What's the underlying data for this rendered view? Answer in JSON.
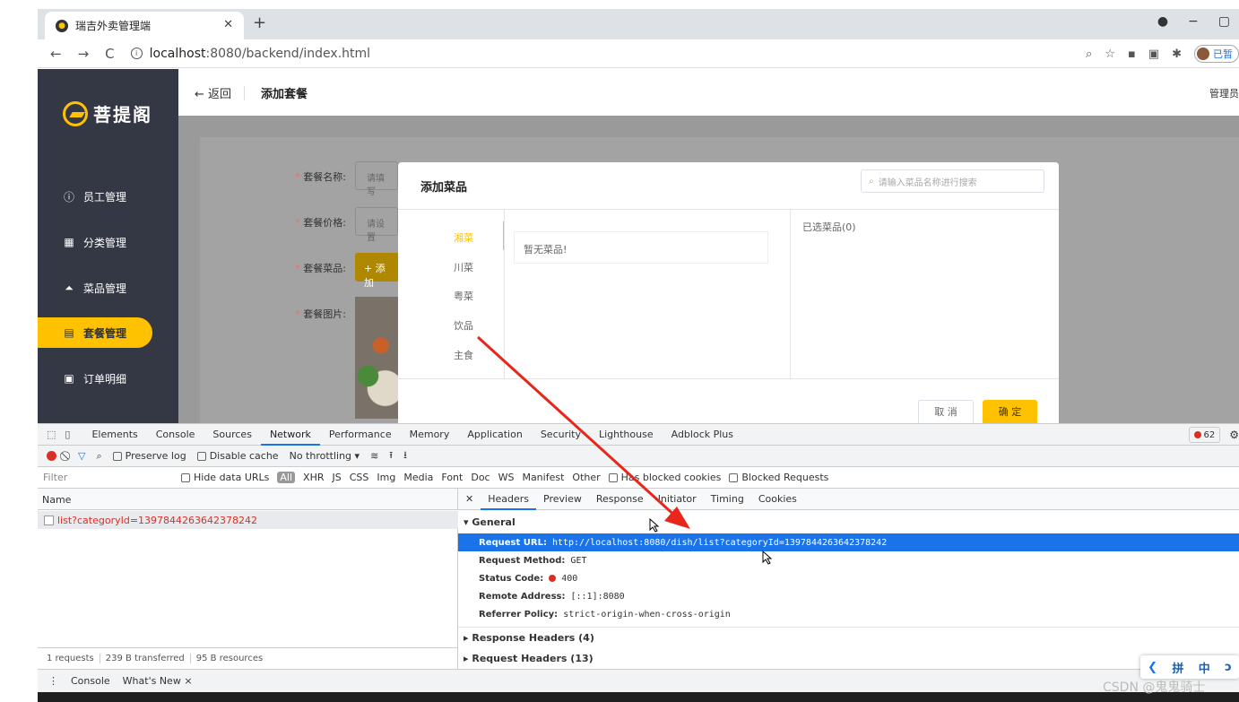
{
  "browser": {
    "tab_title": "瑞吉外卖管理端",
    "url_host": "localhost",
    "url_path": ":8080/backend/index.html",
    "profile_label": "已暂"
  },
  "app": {
    "logo_text": "菩提阁",
    "menu": [
      {
        "label": "员工管理",
        "icon": "info-icon"
      },
      {
        "label": "分类管理",
        "icon": "grid-icon"
      },
      {
        "label": "菜品管理",
        "icon": "dish-icon"
      },
      {
        "label": "套餐管理",
        "icon": "gift-icon",
        "active": true
      },
      {
        "label": "订单明细",
        "icon": "clipboard-icon"
      }
    ],
    "back_label": "返回",
    "page_title": "添加套餐",
    "admin_label": "管理员"
  },
  "form": {
    "name_label": "套餐名称:",
    "name_placeholder": "请填写",
    "price_label": "套餐价格:",
    "price_placeholder": "请设置",
    "dishes_label": "套餐菜品:",
    "add_button": "+ 添加",
    "image_label": "套餐图片:"
  },
  "dialog": {
    "title": "添加菜品",
    "search_placeholder": "请输入菜品名称进行搜索",
    "categories": [
      "湘菜",
      "川菜",
      "粤菜",
      "饮品",
      "主食"
    ],
    "empty_text": "暂无菜品!",
    "selected_label": "已选菜品(0)",
    "cancel": "取 消",
    "confirm": "确 定"
  },
  "devtools": {
    "tabs": [
      "Elements",
      "Console",
      "Sources",
      "Network",
      "Performance",
      "Memory",
      "Application",
      "Security",
      "Lighthouse",
      "Adblock Plus"
    ],
    "active_tab": "Network",
    "error_count": "62",
    "toolbar": {
      "preserve_log": "Preserve log",
      "disable_cache": "Disable cache",
      "throttling": "No throttling"
    },
    "filter": {
      "placeholder": "Filter",
      "hide_data_urls": "Hide data URLs",
      "all": "All",
      "types": [
        "XHR",
        "JS",
        "CSS",
        "Img",
        "Media",
        "Font",
        "Doc",
        "WS",
        "Manifest",
        "Other"
      ],
      "blocked_cookies": "Has blocked cookies",
      "blocked_requests": "Blocked Requests"
    },
    "name_header": "Name",
    "request_name": "list?categoryId=1397844263642378242",
    "summary": [
      "1 requests",
      "239 B transferred",
      "95 B resources"
    ],
    "detail_tabs": [
      "Headers",
      "Preview",
      "Response",
      "Initiator",
      "Timing",
      "Cookies"
    ],
    "general_label": "▾ General",
    "headers": [
      {
        "key": "Request URL:",
        "value": "http://localhost:8080/dish/list?categoryId=1397844263642378242"
      },
      {
        "key": "Request Method:",
        "value": "GET"
      },
      {
        "key": "Status Code:",
        "value": "400"
      },
      {
        "key": "Remote Address:",
        "value": "[::1]:8080"
      },
      {
        "key": "Referrer Policy:",
        "value": "strict-origin-when-cross-origin"
      }
    ],
    "response_headers": "▸ Response Headers (4)",
    "request_headers": "▸ Request Headers (13)",
    "drawer_tabs": [
      "Console",
      "What's New ×"
    ]
  },
  "ime": [
    "拼",
    "中",
    "ↄ"
  ],
  "watermark": "CSDN @鬼鬼骑士",
  "colors": {
    "accent": "#ffc200",
    "sidebar": "#343744",
    "selected_row": "#1a73e8",
    "error": "#d93025",
    "arrow": "#e8261c"
  }
}
